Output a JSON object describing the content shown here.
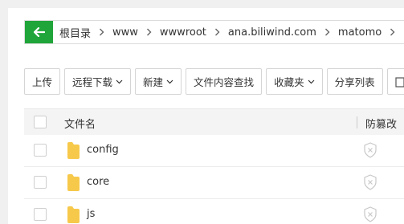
{
  "path": {
    "crumbs": [
      "根目录",
      "www",
      "wwwroot",
      "ana.biliwind.com",
      "matomo"
    ]
  },
  "toolbar": {
    "upload": "上传",
    "remote_download": "远程下载",
    "new": "新建",
    "content_search": "文件内容查找",
    "favorites": "收藏夹",
    "share_list": "分享列表"
  },
  "table": {
    "col_name": "文件名",
    "col_protect": "防篡改",
    "rows": [
      {
        "name": "config"
      },
      {
        "name": "core"
      },
      {
        "name": "js"
      }
    ]
  },
  "colors": {
    "accent": "#20a53a",
    "folder": "#f7c94b"
  }
}
